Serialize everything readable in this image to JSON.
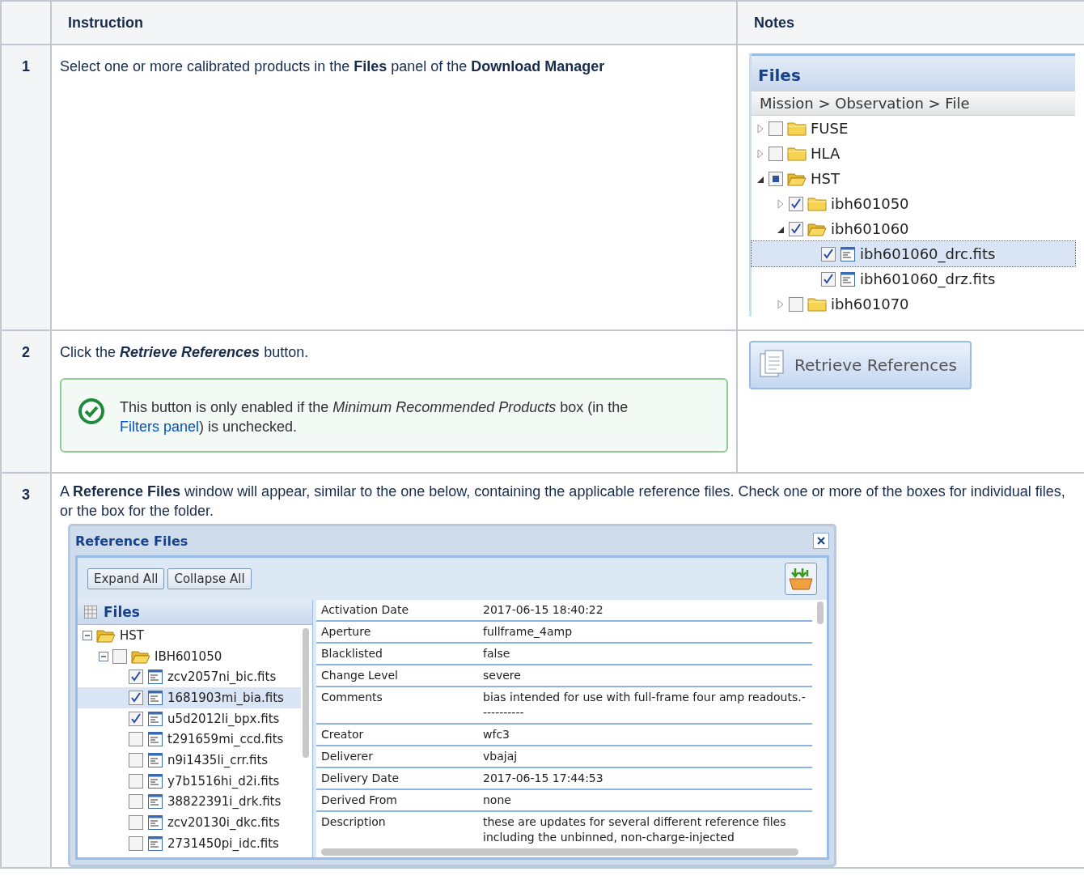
{
  "columns": [
    {
      "label": "Instruction"
    },
    {
      "label": "Notes"
    }
  ],
  "steps": [
    {
      "number": "1",
      "text": "Select one or more calibrated products in the **Files** panel of the **Download Manager**",
      "files_panel": {
        "title": "Files",
        "breadcrumb": "Mission > Observation > File",
        "tree": [
          {
            "kind": "folder",
            "label": "FUSE",
            "expanded": false,
            "checked": false,
            "partial": false,
            "selected": false
          },
          {
            "kind": "folder",
            "label": "HLA",
            "expanded": false,
            "checked": false,
            "partial": false,
            "selected": false
          },
          {
            "kind": "folder",
            "label": "HST",
            "expanded": true,
            "checked": false,
            "partial": true,
            "selected": false,
            "children": [
              {
                "kind": "folder",
                "label": "ibh601050",
                "expanded": false,
                "checked": true,
                "partial": false,
                "selected": false
              },
              {
                "kind": "folder",
                "label": "ibh601060",
                "expanded": true,
                "checked": true,
                "partial": false,
                "selected": false,
                "children": [
                  {
                    "kind": "file",
                    "label": "ibh601060_drc.fits",
                    "checked": true,
                    "partial": false,
                    "selected": true
                  },
                  {
                    "kind": "file",
                    "label": "ibh601060_drz.fits",
                    "checked": true,
                    "partial": false,
                    "selected": false
                  }
                ]
              },
              {
                "kind": "folder",
                "label": "ibh601070",
                "expanded": false,
                "checked": false,
                "partial": false,
                "selected": false
              }
            ]
          }
        ]
      }
    },
    {
      "number": "2",
      "text": "Click the **Retrieve References** button.",
      "note": {
        "before": "This button is only enabled if the *Minimum Recommended Products* box (in the ",
        "link": "Filters panel",
        "after": ") is unchecked."
      },
      "button": {
        "label": "Retrieve References"
      }
    },
    {
      "number": "3",
      "text": "A **Reference Files** window will appear, similar to the one below, containing the applicable reference files. Check one or more of the boxes for individual files, or the box for the folder.",
      "window": {
        "title": "Reference Files",
        "buttons": [
          "Expand All",
          "Collapse All"
        ],
        "files_title": "Files",
        "tree": [
          {
            "kind": "folder",
            "label": "HST",
            "expanded": true,
            "checkbox": false,
            "selected": false,
            "children": [
              {
                "kind": "folder",
                "label": "IBH601050",
                "expanded": true,
                "checkbox": true,
                "checked": false,
                "selected": false,
                "children": [
                  {
                    "kind": "file",
                    "label": "zcv2057ni_bic.fits",
                    "checkbox": true,
                    "checked": true,
                    "selected": false
                  },
                  {
                    "kind": "file",
                    "label": "1681903mi_bia.fits",
                    "checkbox": true,
                    "checked": true,
                    "selected": true
                  },
                  {
                    "kind": "file",
                    "label": "u5d2012li_bpx.fits",
                    "checkbox": true,
                    "checked": true,
                    "selected": false
                  },
                  {
                    "kind": "file",
                    "label": "t291659mi_ccd.fits",
                    "checkbox": true,
                    "checked": false,
                    "selected": false
                  },
                  {
                    "kind": "file",
                    "label": "n9i1435li_crr.fits",
                    "checkbox": true,
                    "checked": false,
                    "selected": false
                  },
                  {
                    "kind": "file",
                    "label": "y7b1516hi_d2i.fits",
                    "checkbox": true,
                    "checked": false,
                    "selected": false
                  },
                  {
                    "kind": "file",
                    "label": "38822391i_drk.fits",
                    "checkbox": true,
                    "checked": false,
                    "selected": false
                  },
                  {
                    "kind": "file",
                    "label": "zcv20130i_dkc.fits",
                    "checkbox": true,
                    "checked": false,
                    "selected": false
                  },
                  {
                    "kind": "file",
                    "label": "2731450pi_idc.fits",
                    "checkbox": true,
                    "checked": false,
                    "selected": false
                  }
                ]
              }
            ]
          }
        ],
        "properties": [
          {
            "name": "Activation Date",
            "value": "2017-06-15 18:40:22"
          },
          {
            "name": "Aperture",
            "value": "fullframe_4amp"
          },
          {
            "name": "Blacklisted",
            "value": "false"
          },
          {
            "name": "Change Level",
            "value": "severe"
          },
          {
            "name": "Comments",
            "value": "bias intended for use with full-frame four amp readouts.-----------"
          },
          {
            "name": "Creator",
            "value": "wfc3"
          },
          {
            "name": "Deliverer",
            "value": "vbajaj"
          },
          {
            "name": "Delivery Date",
            "value": "2017-06-15 17:44:53"
          },
          {
            "name": "Derived From",
            "value": "none"
          },
          {
            "name": "Description",
            "value": "these are updates for several different reference files including the unbinned, non-charge-injected"
          }
        ]
      }
    }
  ]
}
